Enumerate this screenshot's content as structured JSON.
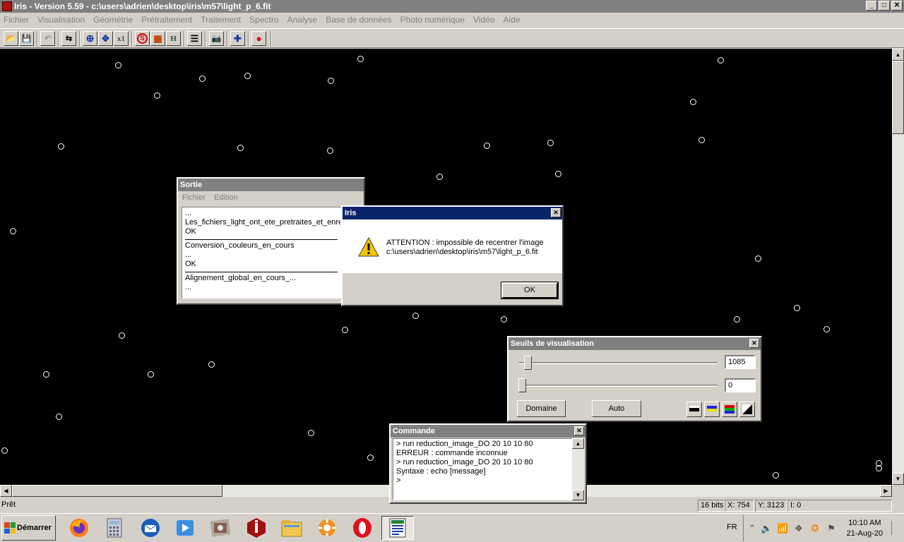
{
  "window": {
    "title": "Iris - Version 5.59 - c:\\users\\adrien\\desktop\\iris\\m57\\light_p_6.fit",
    "min_label": "_",
    "max_label": "□",
    "close_label": "✕"
  },
  "menu": [
    "Fichier",
    "Visualisation",
    "Géométrie",
    "Prétraitement",
    "Traitement",
    "Spectro",
    "Analyse",
    "Base de données",
    "Photo numérique",
    "Vidéo",
    "Aide"
  ],
  "toolbar": {
    "buttons": [
      {
        "name": "open-icon",
        "label": "📂"
      },
      {
        "name": "save-icon",
        "label": "💾"
      },
      {
        "name": "undo-icon",
        "label": "↶"
      },
      {
        "name": "levels-icon",
        "label": "⇆"
      },
      {
        "name": "zoom-in-icon",
        "label": "⊕"
      },
      {
        "name": "move-icon",
        "label": "✥"
      },
      {
        "name": "scale-x1-icon",
        "label": "x1"
      },
      {
        "name": "stop-icon",
        "label": "S"
      },
      {
        "name": "palette-icon",
        "label": "▦"
      },
      {
        "name": "header-icon",
        "label": "H"
      },
      {
        "name": "list-icon",
        "label": "☰"
      },
      {
        "name": "camera-icon",
        "label": "📷"
      },
      {
        "name": "center-icon",
        "label": "✚"
      },
      {
        "name": "record-icon",
        "label": "●"
      }
    ]
  },
  "status": {
    "text": "Prêt",
    "bits": "16 bits",
    "x": "X: 754",
    "y": "Y: 3123",
    "i": "I: 0"
  },
  "sortie": {
    "title": "Sortie",
    "menu": [
      "Fichier",
      "Edition"
    ],
    "lines": [
      "...",
      "Les_fichiers_light_ont_ete_pretraites_et_enregistres",
      "OK",
      "Conversion_couleurs_en_cours",
      "...",
      "OK",
      "Alignement_global_en_cours_...",
      "..."
    ]
  },
  "dialog": {
    "title": "Iris",
    "message_line1": "ATTENTION : impossible de recentrer l'image",
    "message_line2": "c:\\users\\adrien\\desktop\\iris\\m57\\light_p_6.fit",
    "ok_label": "OK",
    "close_label": "✕"
  },
  "seuils": {
    "title": "Seuils de visualisation",
    "high_value": "1085",
    "low_value": "0",
    "high_level": 0.03,
    "low_level": 0.0,
    "domaine_label": "Domaine",
    "auto_label": "Auto",
    "close_label": "✕"
  },
  "commande": {
    "title": "Commande",
    "lines": [
      "> run reduction_image_DO 20 10 10 80",
      "ERREUR : commande inconnue",
      "> run reduction_image_DO 20 10 10 80",
      "Syntaxe : echo [message]",
      ">"
    ],
    "close_label": "✕"
  },
  "taskbar": {
    "start_label": "Démarrer",
    "lang": "FR",
    "time": "10:10 AM",
    "date": "21-Aug-20",
    "apps": [
      "firefox-icon",
      "calculator-icon",
      "thunderbird-icon",
      "media-player-icon",
      "sextractor-icon",
      "iris-icon",
      "file-explorer-icon",
      "settings-icon",
      "opera-icon",
      "iris-window-icon"
    ]
  }
}
